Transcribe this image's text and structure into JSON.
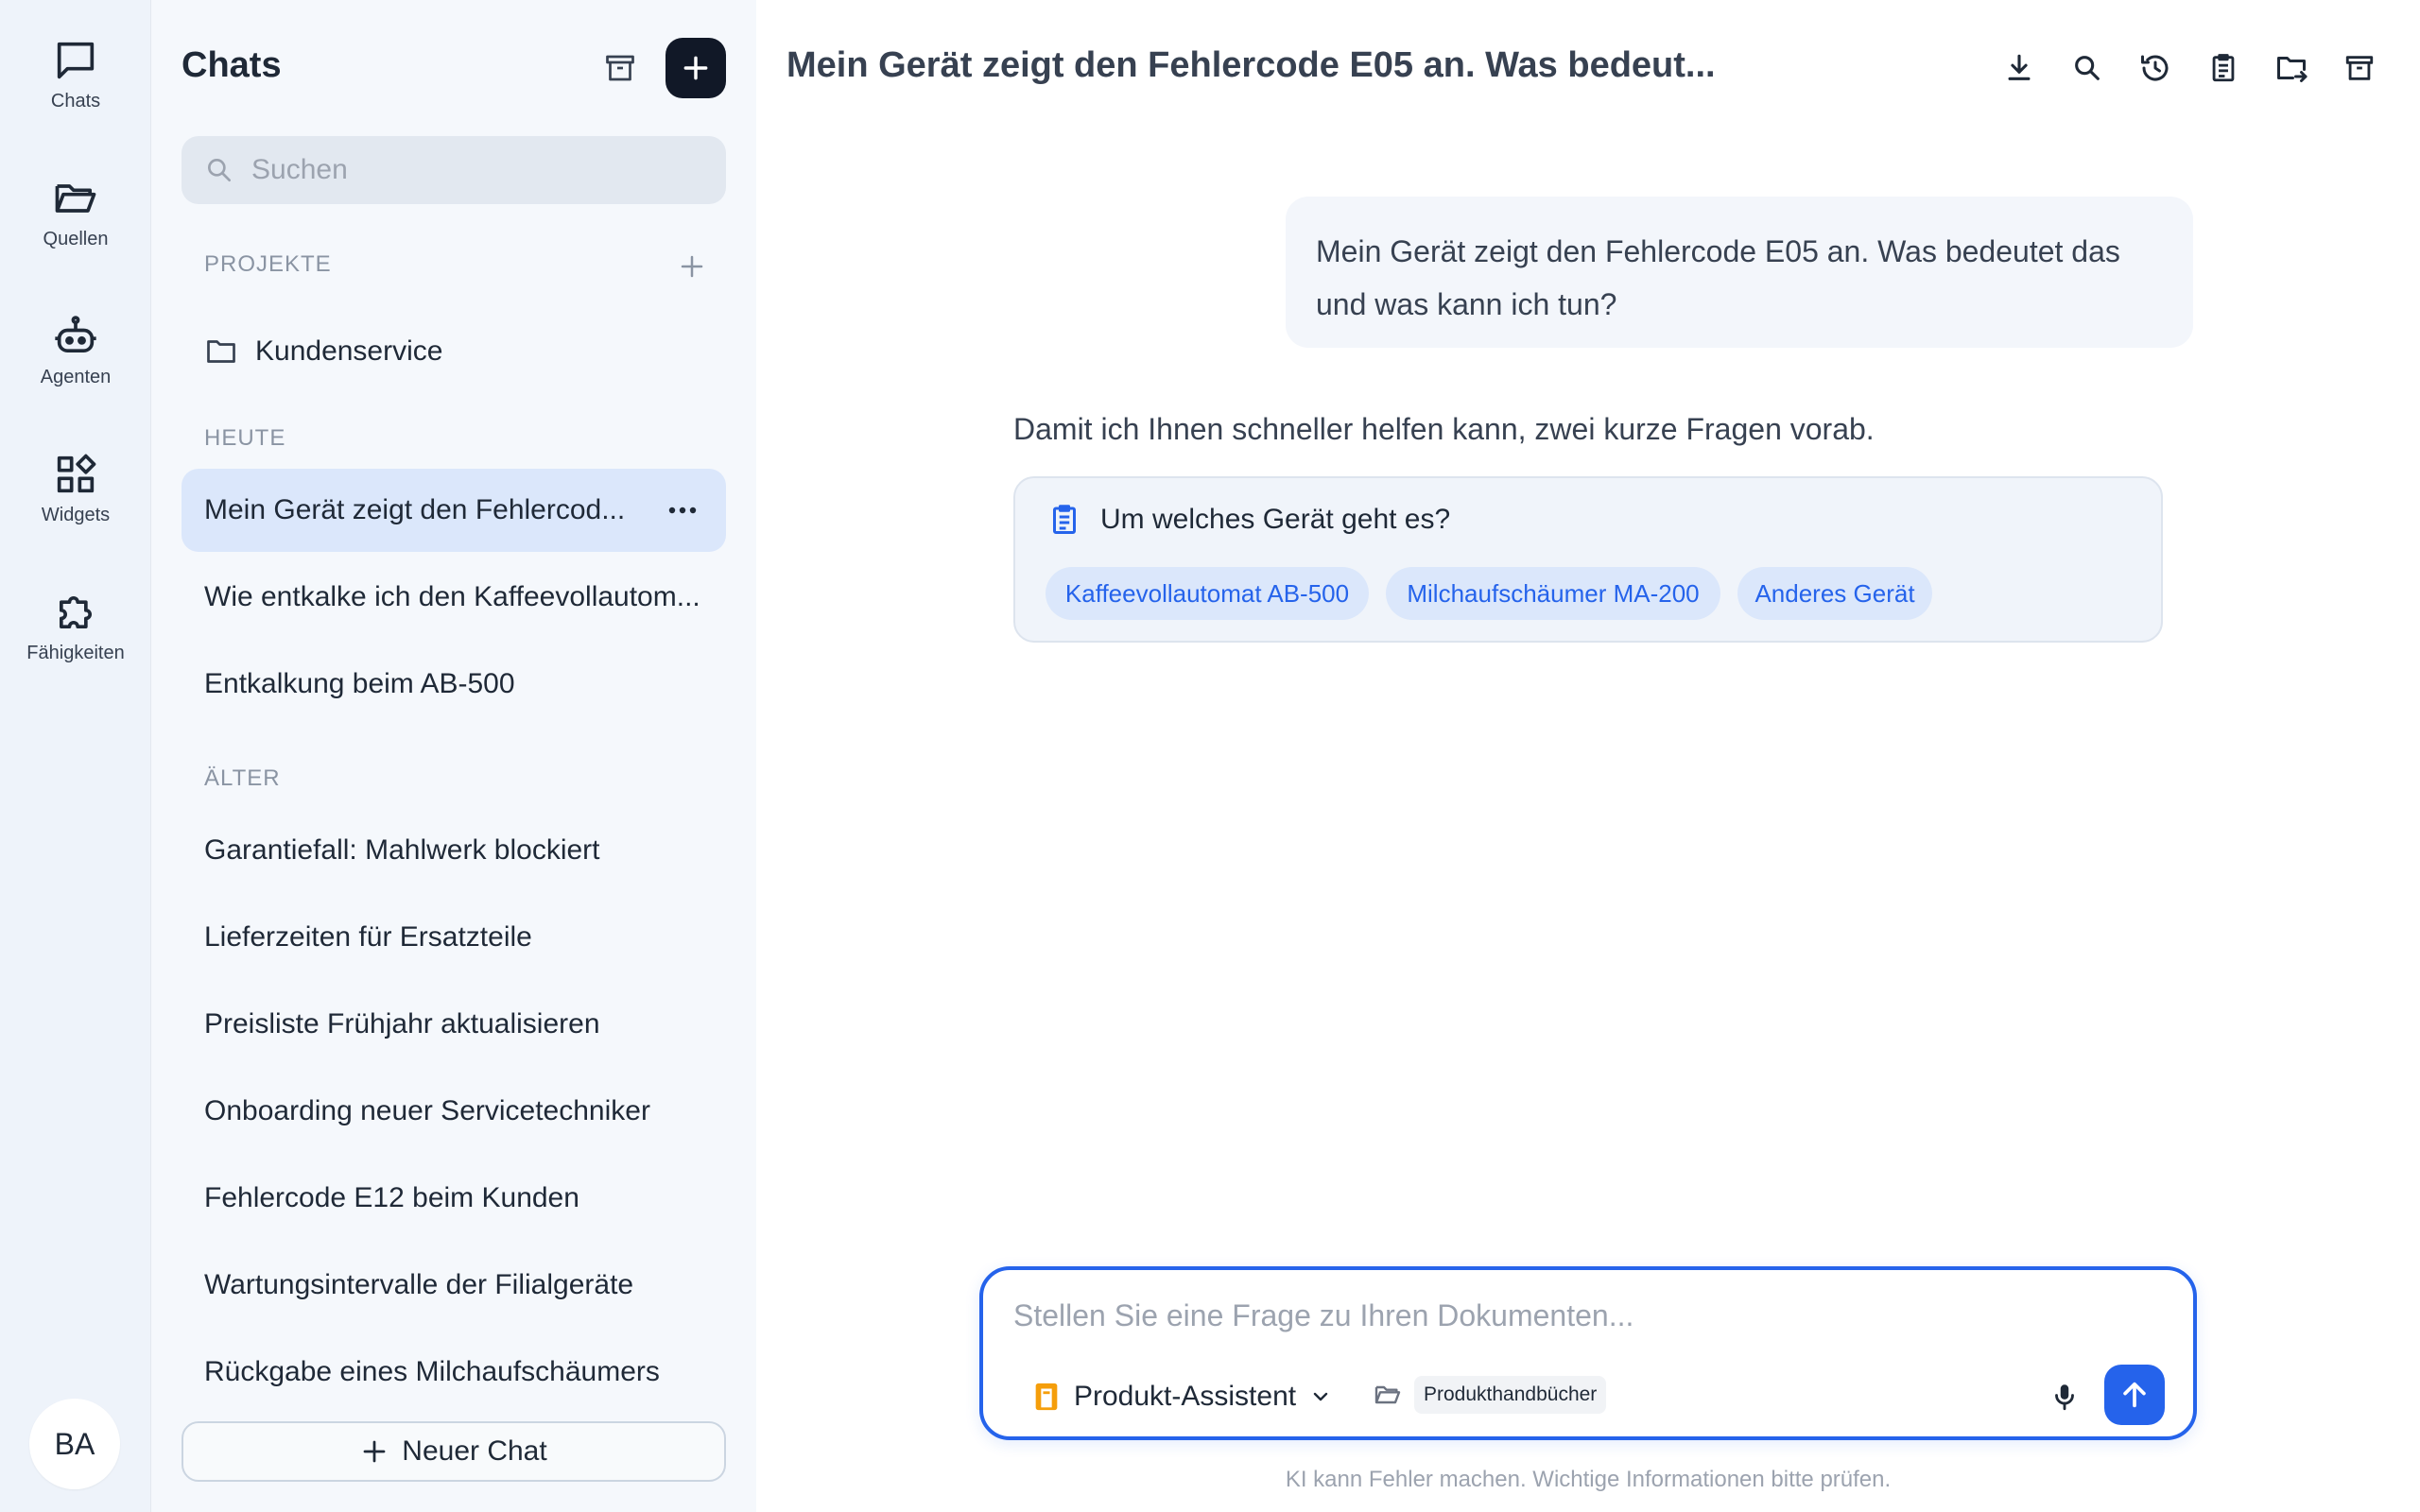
{
  "rail": {
    "items": [
      {
        "label": "Chats",
        "icon": "chat-bubble-icon"
      },
      {
        "label": "Quellen",
        "icon": "folder-open-icon"
      },
      {
        "label": "Agenten",
        "icon": "robot-icon"
      },
      {
        "label": "Widgets",
        "icon": "widgets-icon"
      },
      {
        "label": "Fähigkeiten",
        "icon": "puzzle-icon"
      }
    ],
    "avatar_initials": "BA"
  },
  "sidebar": {
    "title": "Chats",
    "search_placeholder": "Suchen",
    "projects_label": "PROJEKTE",
    "projects": [
      {
        "label": "Kundenservice"
      }
    ],
    "today_label": "HEUTE",
    "today": [
      {
        "label": "Mein Gerät zeigt den Fehlercod...",
        "active": true
      },
      {
        "label": "Wie entkalke ich den Kaffeevollautom..."
      },
      {
        "label": "Entkalkung beim AB-500"
      }
    ],
    "older_label": "ÄLTER",
    "older": [
      {
        "label": "Garantiefall: Mahlwerk blockiert"
      },
      {
        "label": "Lieferzeiten für Ersatzteile"
      },
      {
        "label": "Preisliste Frühjahr aktualisieren"
      },
      {
        "label": "Onboarding neuer Servicetechniker"
      },
      {
        "label": "Fehlercode E12 beim Kunden"
      },
      {
        "label": "Wartungsintervalle der Filialgeräte"
      },
      {
        "label": "Rückgabe eines Milchaufschäumers"
      }
    ],
    "new_chat_label": "Neuer Chat"
  },
  "main": {
    "title": "Mein Gerät zeigt den Fehlercode E05 an. Was bedeut...",
    "toolbar_icons": [
      "download-icon",
      "search-icon",
      "history-icon",
      "clipboard-icon",
      "move-folder-icon",
      "archive-icon"
    ],
    "user_message": "Mein Gerät zeigt den Fehlercode E05 an. Was bedeutet das und was kann ich tun?",
    "assistant_message": "Damit ich Ihnen schneller helfen kann, zwei kurze Fragen vorab.",
    "question": {
      "text": "Um welches Gerät geht es?",
      "options": [
        "Kaffeevollautomat AB-500",
        "Milchaufschäumer MA-200",
        "Anderes Gerät"
      ]
    },
    "composer": {
      "placeholder": "Stellen Sie eine Frage zu Ihren Dokumenten...",
      "agent": "Produkt-Assistent",
      "source": "Produkthandbücher"
    },
    "disclaimer": "KI kann Fehler machen. Wichtige Informationen bitte prüfen."
  },
  "colors": {
    "accent": "#2563eb",
    "chip_bg": "#dbe7fb",
    "rail_bg": "#eef3fa",
    "sidebar_bg": "#f5f8fc",
    "agent_icon": "#f59e0b"
  }
}
